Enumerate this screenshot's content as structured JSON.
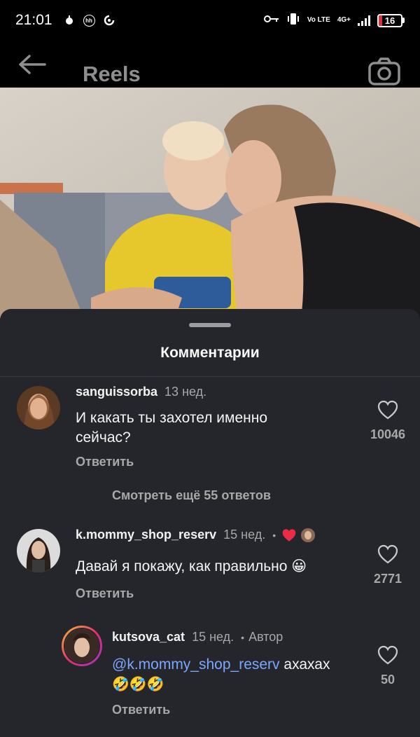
{
  "status_bar": {
    "time": "21:01",
    "left_icons": [
      "notification-icon",
      "hh-app-icon",
      "sync-app-icon"
    ],
    "right_icons": [
      "key-icon",
      "vibrate-icon"
    ],
    "network": "Vo LTE",
    "mobile": "4G+",
    "battery_level": "16",
    "battery_color": "#e0313b"
  },
  "header": {
    "title": "Reels"
  },
  "comments_sheet": {
    "title": "Комментарии",
    "more_replies": "Смотреть ещё 55 ответов",
    "comments": [
      {
        "username": "sanguissorba",
        "time": "13 нед.",
        "text": "И какать ты захотел именно сейчас?",
        "reply": "Ответить",
        "likes": "10046"
      },
      {
        "username": "k.mommy_shop_reserv",
        "time": "15 нед.",
        "text": "Давай я покажу, как правильно 😀",
        "reply": "Ответить",
        "likes": "2771"
      }
    ],
    "reply_comment": {
      "username": "kutsova_cat",
      "time": "15 нед.",
      "author_tag": "Автор",
      "mention": "@k.mommy_shop_reserv",
      "text": " ахахах",
      "emojis": "🤣🤣🤣",
      "reply": "Ответить",
      "likes": "50"
    }
  },
  "colors": {
    "sheet_bg": "#25262b",
    "accent_link": "#7aa7ff",
    "liked_heart": "#ed2b45"
  }
}
